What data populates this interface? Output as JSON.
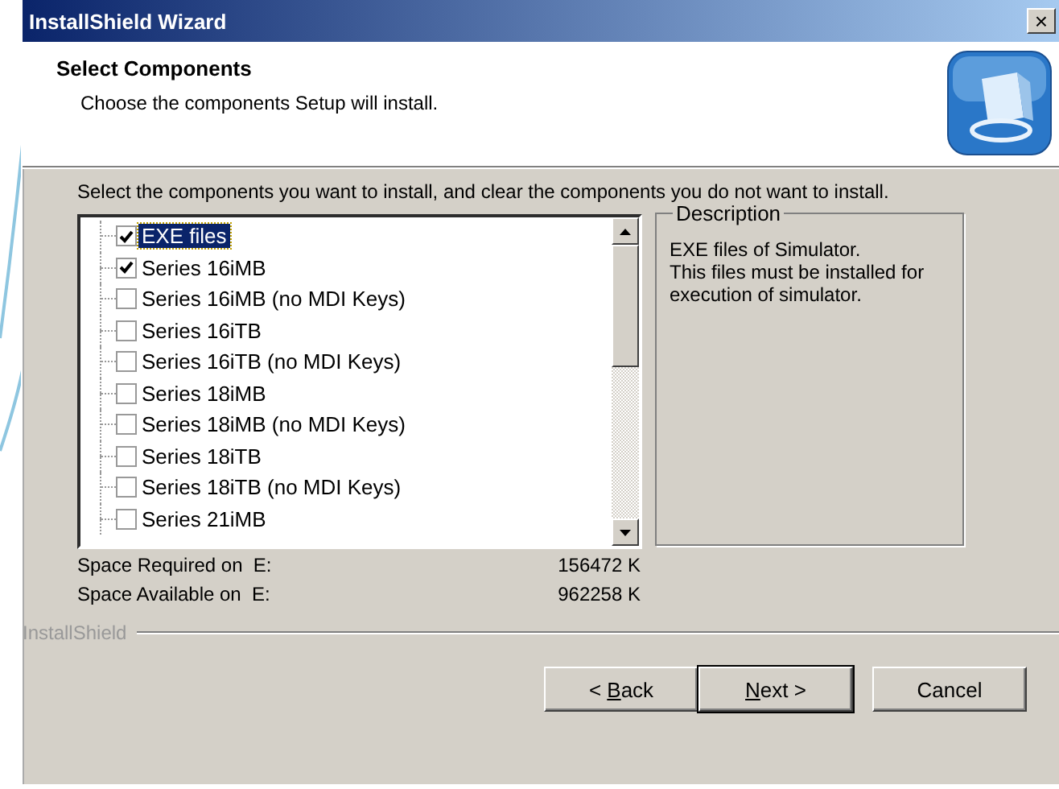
{
  "window": {
    "title": "InstallShield Wizard",
    "close": "×"
  },
  "header": {
    "title": "Select Components",
    "subtitle": "Choose the components Setup will install."
  },
  "instruction": "Select the components you want to install, and clear the components you do not want to install.",
  "components": [
    {
      "label": "EXE files",
      "checked": true,
      "selected": true
    },
    {
      "label": "Series 16iMB",
      "checked": true,
      "selected": false
    },
    {
      "label": "Series 16iMB (no MDI Keys)",
      "checked": false,
      "selected": false
    },
    {
      "label": "Series 16iTB",
      "checked": false,
      "selected": false
    },
    {
      "label": "Series 16iTB (no MDI Keys)",
      "checked": false,
      "selected": false
    },
    {
      "label": "Series 18iMB",
      "checked": false,
      "selected": false
    },
    {
      "label": "Series 18iMB (no MDI Keys)",
      "checked": false,
      "selected": false
    },
    {
      "label": "Series 18iTB",
      "checked": false,
      "selected": false
    },
    {
      "label": "Series 18iTB (no MDI Keys)",
      "checked": false,
      "selected": false
    },
    {
      "label": "Series 21iMB",
      "checked": false,
      "selected": false
    }
  ],
  "description": {
    "title": "Description",
    "text": "EXE files of Simulator.\nThis files must be installed for execution of simulator."
  },
  "space": [
    {
      "label": "Space Required on  E:",
      "value": "156472 K"
    },
    {
      "label": "Space Available on  E:",
      "value": "962258 K"
    }
  ],
  "brand": "InstallShield",
  "buttons": [
    {
      "before": "< ",
      "key": "B",
      "after": "ack",
      "default": false
    },
    {
      "key": "N",
      "after": "ext >",
      "default": true
    },
    {
      "before": "Cancel",
      "default": false
    }
  ]
}
